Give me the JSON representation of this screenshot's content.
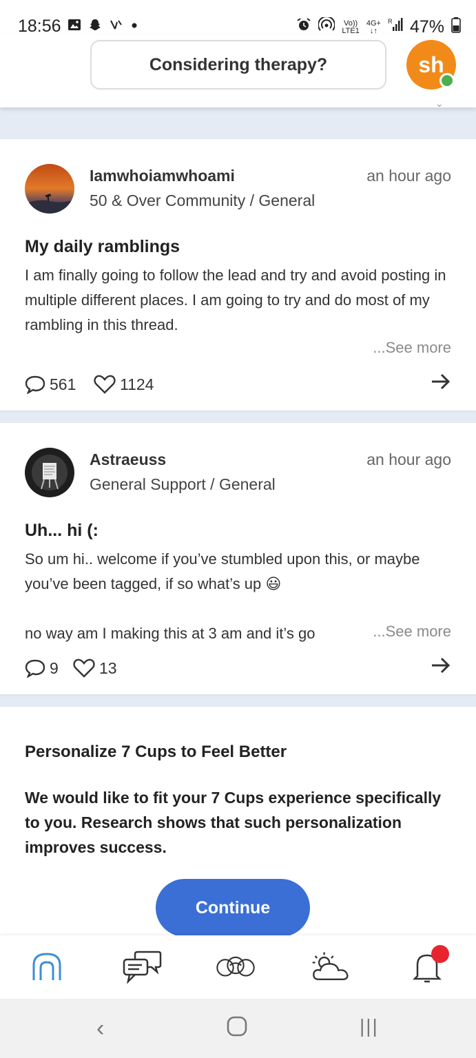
{
  "status_bar": {
    "time": "18:56",
    "left_icons": [
      "gallery-icon",
      "snapchat-icon",
      "missed-call-icon",
      "dot-icon"
    ],
    "network_top": "Vo))",
    "network_bottom": "LTE1",
    "network_type": "4G+",
    "roaming": "R",
    "battery": "47%"
  },
  "header": {
    "therapy_label": "Considering therapy?",
    "avatar_initials": "sh",
    "brand_color": "#f28a19"
  },
  "posts": [
    {
      "username": "Iamwhoiamwhoami",
      "time": "an hour ago",
      "community": "50 & Over Community / General",
      "title": "My daily ramblings",
      "body": "I am finally going to follow the lead and try and avoid posting in multiple different places. I am going to try and do most of my rambling in this thread.",
      "see_more": "...See more",
      "comments": "561",
      "likes": "1124"
    },
    {
      "username": "Astraeuss",
      "time": "an hour ago",
      "community": "General Support / General",
      "title": "Uh... hi (:",
      "body_line1": "So um hi.. welcome if you’ve stumbled upon this, or maybe you’ve been tagged, if so what’s up 😃",
      "body_line2": "no way am I making this at 3 am and it’s go",
      "see_more": "...See more",
      "comments": "9",
      "likes": "13"
    }
  ],
  "personalize": {
    "title": "Personalize 7 Cups to Feel Better",
    "text": "We would like to fit your 7 Cups experience specifically to you. Research shows that such personalization improves success.",
    "button": "Continue",
    "button_color": "#3b6fd6"
  },
  "bottom_nav": {
    "items": [
      "home-icon",
      "chat-icon",
      "community-icon",
      "weather-icon",
      "bell-icon"
    ],
    "active_color": "#3a8ed8",
    "notif_color": "#e8252e"
  },
  "android_nav": {
    "back": "‹",
    "home": "▢",
    "recents": "|||"
  }
}
